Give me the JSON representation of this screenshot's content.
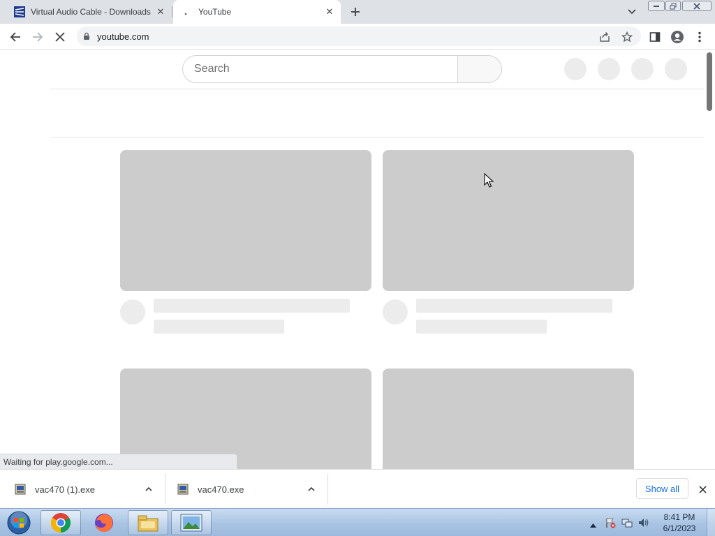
{
  "browser": {
    "tabs": [
      {
        "title": "Virtual Audio Cable - Downloads",
        "favicon": "vac-logo-icon"
      },
      {
        "title": "YouTube",
        "favicon": "loading-dot-icon"
      }
    ],
    "url": "youtube.com"
  },
  "page": {
    "search_placeholder": "Search"
  },
  "status_text": "Waiting for play.google.com...",
  "downloads": {
    "items": [
      {
        "name": "vac470 (1).exe"
      },
      {
        "name": "vac470.exe"
      }
    ],
    "show_all_label": "Show all"
  },
  "taskbar": {
    "apps": [
      "chrome",
      "firefox",
      "file-explorer",
      "image-viewer"
    ],
    "time": "8:41 PM",
    "date": "6/1/2023"
  },
  "colors": {
    "skeleton_thumb": "#cccccc",
    "skeleton_text": "#ececec",
    "link_blue": "#1a73e8"
  }
}
